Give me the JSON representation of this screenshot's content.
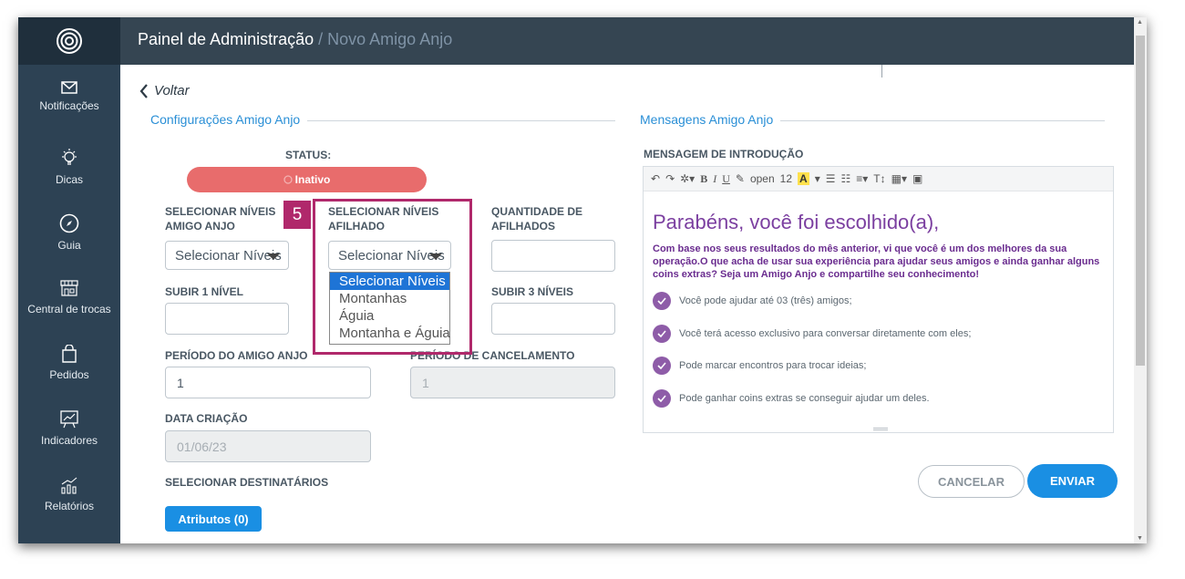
{
  "header": {
    "title": "Painel de Administração",
    "separator": " / ",
    "current": "Novo Amigo Anjo"
  },
  "sidebar": {
    "items": [
      {
        "label": "Notificações",
        "icon": "envelope-icon"
      },
      {
        "label": "Dicas",
        "icon": "lightbulb-icon"
      },
      {
        "label": "Guia",
        "icon": "compass-icon"
      },
      {
        "label": "Central de trocas",
        "icon": "store-icon"
      },
      {
        "label": "Pedidos",
        "icon": "shopping-bag-icon"
      },
      {
        "label": "Indicadores",
        "icon": "chart-board-icon"
      },
      {
        "label": "Relatórios",
        "icon": "report-chart-icon"
      }
    ]
  },
  "back_label": "Voltar",
  "config": {
    "section_title": "Configurações Amigo Anjo",
    "status_label": "STATUS:",
    "status_value": "Inativo",
    "niveis_amigo_label": "SELECIONAR NÍVEIS AMIGO ANJO",
    "niveis_amigo_value": "Selecionar Níveis",
    "niveis_afilhado_label": "SELECIONAR NÍVEIS AFILHADO",
    "niveis_afilhado_value": "Selecionar Níveis",
    "quantidade_label": "QUANTIDADE DE AFILHADOS",
    "quantidade_value": "",
    "subir1_label": "SUBIR 1 NÍVEL",
    "subir1_value": "",
    "subir3_label": "SUBIR 3 NÍVEIS",
    "subir3_value": "",
    "periodo_label": "PERÍODO DO AMIGO ANJO",
    "periodo_value": "1",
    "cancelamento_label": "PERÍODO DE CANCELAMENTO",
    "cancelamento_value": "1",
    "data_label": "DATA CRIAÇÃO",
    "data_value": "01/06/23",
    "destinatarios_label": "SELECIONAR DESTINATÁRIOS",
    "atributos_button": "Atributos (0)"
  },
  "dropdown_options": [
    "Selecionar Níveis",
    "Montanhas",
    "Águia",
    "Montanha e Águia"
  ],
  "step_badge": "5",
  "messages": {
    "section_title": "Mensagens Amigo Anjo",
    "intro_label": "MENSAGEM DE INTRODUÇÃO",
    "toolbar": {
      "font": "open",
      "size": "12",
      "bold": "B",
      "italic": "I",
      "underline": "U",
      "highlight": "A",
      "text_size": "T↕"
    },
    "heading": "Parabéns, você foi escolhido(a),",
    "intro_text": "Com base nos seus resultados do mês anterior, vi que você é um dos melhores da sua operação.O que acha de usar sua experiência para ajudar seus amigos e ainda ganhar alguns coins extras? Seja um Amigo Anjo e compartilhe seu conhecimento!",
    "bullets": [
      "Você pode ajudar até 03 (três) amigos;",
      "Você terá acesso exclusivo para conversar diretamente com eles;",
      "Pode marcar encontros para trocar ideias;",
      "Pode ganhar coins extras se conseguir ajudar um deles."
    ]
  },
  "actions": {
    "cancel": "CANCELAR",
    "send": "ENVIAR"
  },
  "colors": {
    "accent": "#1a8fe3",
    "status_inactive": "#e86c6c",
    "highlight_box": "#b0286b",
    "sidebar": "#2d4254",
    "message_purple": "#7b3fa0"
  }
}
